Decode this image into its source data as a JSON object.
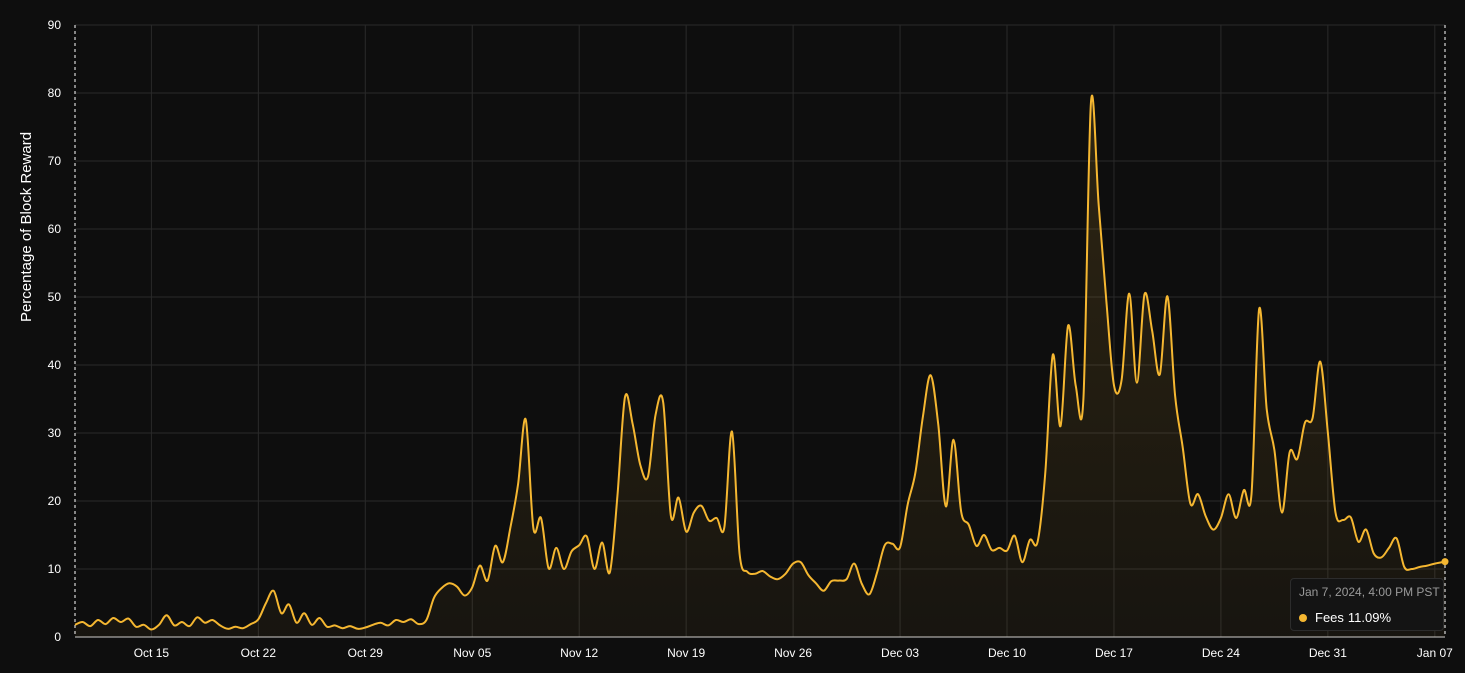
{
  "colors": {
    "background": "#0e0e0e",
    "series": "#f5b731",
    "grid": "#2a2a2a",
    "text": "#ffffff"
  },
  "tooltip": {
    "date": "Jan 7, 2024, 4:00 PM PST",
    "series_name": "Fees",
    "value_text": "11.09%"
  },
  "chart_data": {
    "type": "area",
    "ylabel": "Percentage of Block Reward",
    "xlabel": "",
    "title": "",
    "ylim": [
      0,
      90
    ],
    "xlim": [
      "2023-10-10",
      "2024-01-07T16:00"
    ],
    "yticks": [
      0,
      10,
      20,
      30,
      40,
      50,
      60,
      70,
      80,
      90
    ],
    "xticks": [
      {
        "date": "2023-10-15",
        "label": "Oct 15"
      },
      {
        "date": "2023-10-22",
        "label": "Oct 22"
      },
      {
        "date": "2023-10-29",
        "label": "Oct 29"
      },
      {
        "date": "2023-11-05",
        "label": "Nov 05"
      },
      {
        "date": "2023-11-12",
        "label": "Nov 12"
      },
      {
        "date": "2023-11-19",
        "label": "Nov 19"
      },
      {
        "date": "2023-11-26",
        "label": "Nov 26"
      },
      {
        "date": "2023-12-03",
        "label": "Dec 03"
      },
      {
        "date": "2023-12-10",
        "label": "Dec 10"
      },
      {
        "date": "2023-12-17",
        "label": "Dec 17"
      },
      {
        "date": "2023-12-24",
        "label": "Dec 24"
      },
      {
        "date": "2023-12-31",
        "label": "Dec 31"
      },
      {
        "date": "2024-01-07",
        "label": "Jan 07"
      }
    ],
    "grid": true,
    "legend": "none",
    "series": [
      {
        "name": "Fees",
        "x": [
          "2023-10-10",
          "2023-10-10T12:00",
          "2023-10-11",
          "2023-10-11T12:00",
          "2023-10-12",
          "2023-10-12T12:00",
          "2023-10-13",
          "2023-10-13T12:00",
          "2023-10-14",
          "2023-10-14T12:00",
          "2023-10-15",
          "2023-10-15T12:00",
          "2023-10-16",
          "2023-10-16T12:00",
          "2023-10-17",
          "2023-10-17T12:00",
          "2023-10-18",
          "2023-10-18T12:00",
          "2023-10-19",
          "2023-10-19T12:00",
          "2023-10-20",
          "2023-10-20T12:00",
          "2023-10-21",
          "2023-10-21T12:00",
          "2023-10-22",
          "2023-10-22T12:00",
          "2023-10-23",
          "2023-10-23T12:00",
          "2023-10-24",
          "2023-10-24T12:00",
          "2023-10-25",
          "2023-10-25T12:00",
          "2023-10-26",
          "2023-10-26T12:00",
          "2023-10-27",
          "2023-10-27T12:00",
          "2023-10-28",
          "2023-10-28T12:00",
          "2023-10-29",
          "2023-10-29T12:00",
          "2023-10-30",
          "2023-10-30T12:00",
          "2023-10-31",
          "2023-10-31T12:00",
          "2023-11-01",
          "2023-11-01T12:00",
          "2023-11-02",
          "2023-11-02T12:00",
          "2023-11-03",
          "2023-11-03T12:00",
          "2023-11-04",
          "2023-11-04T12:00",
          "2023-11-05",
          "2023-11-05T12:00",
          "2023-11-06",
          "2023-11-06T12:00",
          "2023-11-07",
          "2023-11-07T12:00",
          "2023-11-08",
          "2023-11-08T12:00",
          "2023-11-09",
          "2023-11-09T12:00",
          "2023-11-10",
          "2023-11-10T12:00",
          "2023-11-11",
          "2023-11-11T12:00",
          "2023-11-12",
          "2023-11-12T12:00",
          "2023-11-13",
          "2023-11-13T12:00",
          "2023-11-14",
          "2023-11-14T12:00",
          "2023-11-15",
          "2023-11-15T12:00",
          "2023-11-16",
          "2023-11-16T12:00",
          "2023-11-17",
          "2023-11-17T12:00",
          "2023-11-18",
          "2023-11-18T12:00",
          "2023-11-19",
          "2023-11-19T12:00",
          "2023-11-20",
          "2023-11-20T12:00",
          "2023-11-21",
          "2023-11-21T12:00",
          "2023-11-22",
          "2023-11-22T12:00",
          "2023-11-23",
          "2023-11-23T12:00",
          "2023-11-24",
          "2023-11-24T12:00",
          "2023-11-25",
          "2023-11-25T12:00",
          "2023-11-26",
          "2023-11-26T12:00",
          "2023-11-27",
          "2023-11-27T12:00",
          "2023-11-28",
          "2023-11-28T12:00",
          "2023-11-29",
          "2023-11-29T12:00",
          "2023-11-30",
          "2023-11-30T12:00",
          "2023-12-01",
          "2023-12-01T12:00",
          "2023-12-02",
          "2023-12-02T12:00",
          "2023-12-03",
          "2023-12-03T12:00",
          "2023-12-04",
          "2023-12-04T12:00",
          "2023-12-05",
          "2023-12-05T12:00",
          "2023-12-06",
          "2023-12-06T12:00",
          "2023-12-07",
          "2023-12-07T12:00",
          "2023-12-08",
          "2023-12-08T12:00",
          "2023-12-09",
          "2023-12-09T12:00",
          "2023-12-10",
          "2023-12-10T12:00",
          "2023-12-11",
          "2023-12-11T12:00",
          "2023-12-12",
          "2023-12-12T12:00",
          "2023-12-13",
          "2023-12-13T12:00",
          "2023-12-14",
          "2023-12-14T12:00",
          "2023-12-15",
          "2023-12-15T12:00",
          "2023-12-16",
          "2023-12-16T12:00",
          "2023-12-17",
          "2023-12-17T12:00",
          "2023-12-18",
          "2023-12-18T12:00",
          "2023-12-19",
          "2023-12-19T12:00",
          "2023-12-20",
          "2023-12-20T12:00",
          "2023-12-21",
          "2023-12-21T12:00",
          "2023-12-22",
          "2023-12-22T12:00",
          "2023-12-23",
          "2023-12-23T12:00",
          "2023-12-24",
          "2023-12-24T12:00",
          "2023-12-25",
          "2023-12-25T12:00",
          "2023-12-26",
          "2023-12-26T12:00",
          "2023-12-27",
          "2023-12-27T12:00",
          "2023-12-28",
          "2023-12-28T12:00",
          "2023-12-29",
          "2023-12-29T12:00",
          "2023-12-30",
          "2023-12-30T12:00",
          "2023-12-31",
          "2023-12-31T12:00",
          "2024-01-01",
          "2024-01-01T12:00",
          "2024-01-02",
          "2024-01-02T12:00",
          "2024-01-03",
          "2024-01-03T12:00",
          "2024-01-04",
          "2024-01-04T12:00",
          "2024-01-05",
          "2024-01-05T12:00",
          "2024-01-06",
          "2024-01-06T12:00",
          "2024-01-07",
          "2024-01-07T16:00"
        ],
        "values": [
          1.8,
          2.2,
          1.6,
          2.5,
          1.9,
          2.8,
          2.2,
          2.7,
          1.5,
          1.8,
          1.1,
          1.8,
          3.2,
          1.7,
          2.2,
          1.6,
          2.9,
          2.1,
          2.5,
          1.7,
          1.2,
          1.5,
          1.3,
          1.9,
          2.6,
          5.0,
          6.8,
          3.5,
          4.8,
          2.1,
          3.5,
          1.8,
          2.8,
          1.5,
          1.7,
          1.3,
          1.6,
          1.2,
          1.4,
          1.8,
          2.1,
          1.7,
          2.5,
          2.2,
          2.6,
          1.9,
          2.5,
          5.8,
          7.2,
          7.9,
          7.4,
          6.1,
          7.3,
          10.5,
          8.3,
          13.4,
          11.0,
          16.1,
          22.5,
          32.0,
          16.0,
          17.5,
          10.1,
          13.1,
          10.0,
          12.6,
          13.5,
          14.8,
          10.0,
          13.9,
          9.5,
          20.7,
          35.3,
          31.3,
          25.3,
          23.6,
          32.7,
          34.5,
          17.8,
          20.5,
          15.5,
          18.3,
          19.3,
          17.1,
          17.5,
          16.1,
          30.2,
          12.2,
          9.6,
          9.3,
          9.7,
          8.9,
          8.5,
          9.3,
          10.8,
          11.0,
          9.1,
          7.9,
          6.8,
          8.2,
          8.3,
          8.5,
          10.8,
          7.8,
          6.3,
          9.5,
          13.5,
          13.7,
          13.2,
          19.5,
          24.1,
          32.5,
          38.5,
          31.2,
          19.2,
          29.0,
          18.4,
          16.5,
          13.4,
          15.0,
          12.8,
          13.1,
          12.7,
          14.9,
          11.0,
          14.3,
          14.0,
          24.0,
          41.5,
          31.0,
          45.8,
          36.9,
          35.0,
          78.7,
          63.5,
          49.5,
          37.0,
          37.8,
          50.5,
          37.4,
          50.4,
          45.0,
          38.6,
          50.1,
          35.5,
          27.9,
          19.6,
          21.0,
          17.8,
          15.8,
          17.5,
          21.0,
          17.5,
          21.6,
          21.0,
          48.2,
          33.5,
          27.5,
          18.3,
          27.2,
          26.2,
          31.5,
          32.2,
          40.5,
          30.0,
          18.3,
          17.2,
          17.6,
          14.0,
          15.8,
          12.3,
          11.7,
          13.1,
          14.5,
          10.3,
          10.0,
          10.3,
          10.5,
          10.8,
          11.09
        ]
      }
    ]
  }
}
